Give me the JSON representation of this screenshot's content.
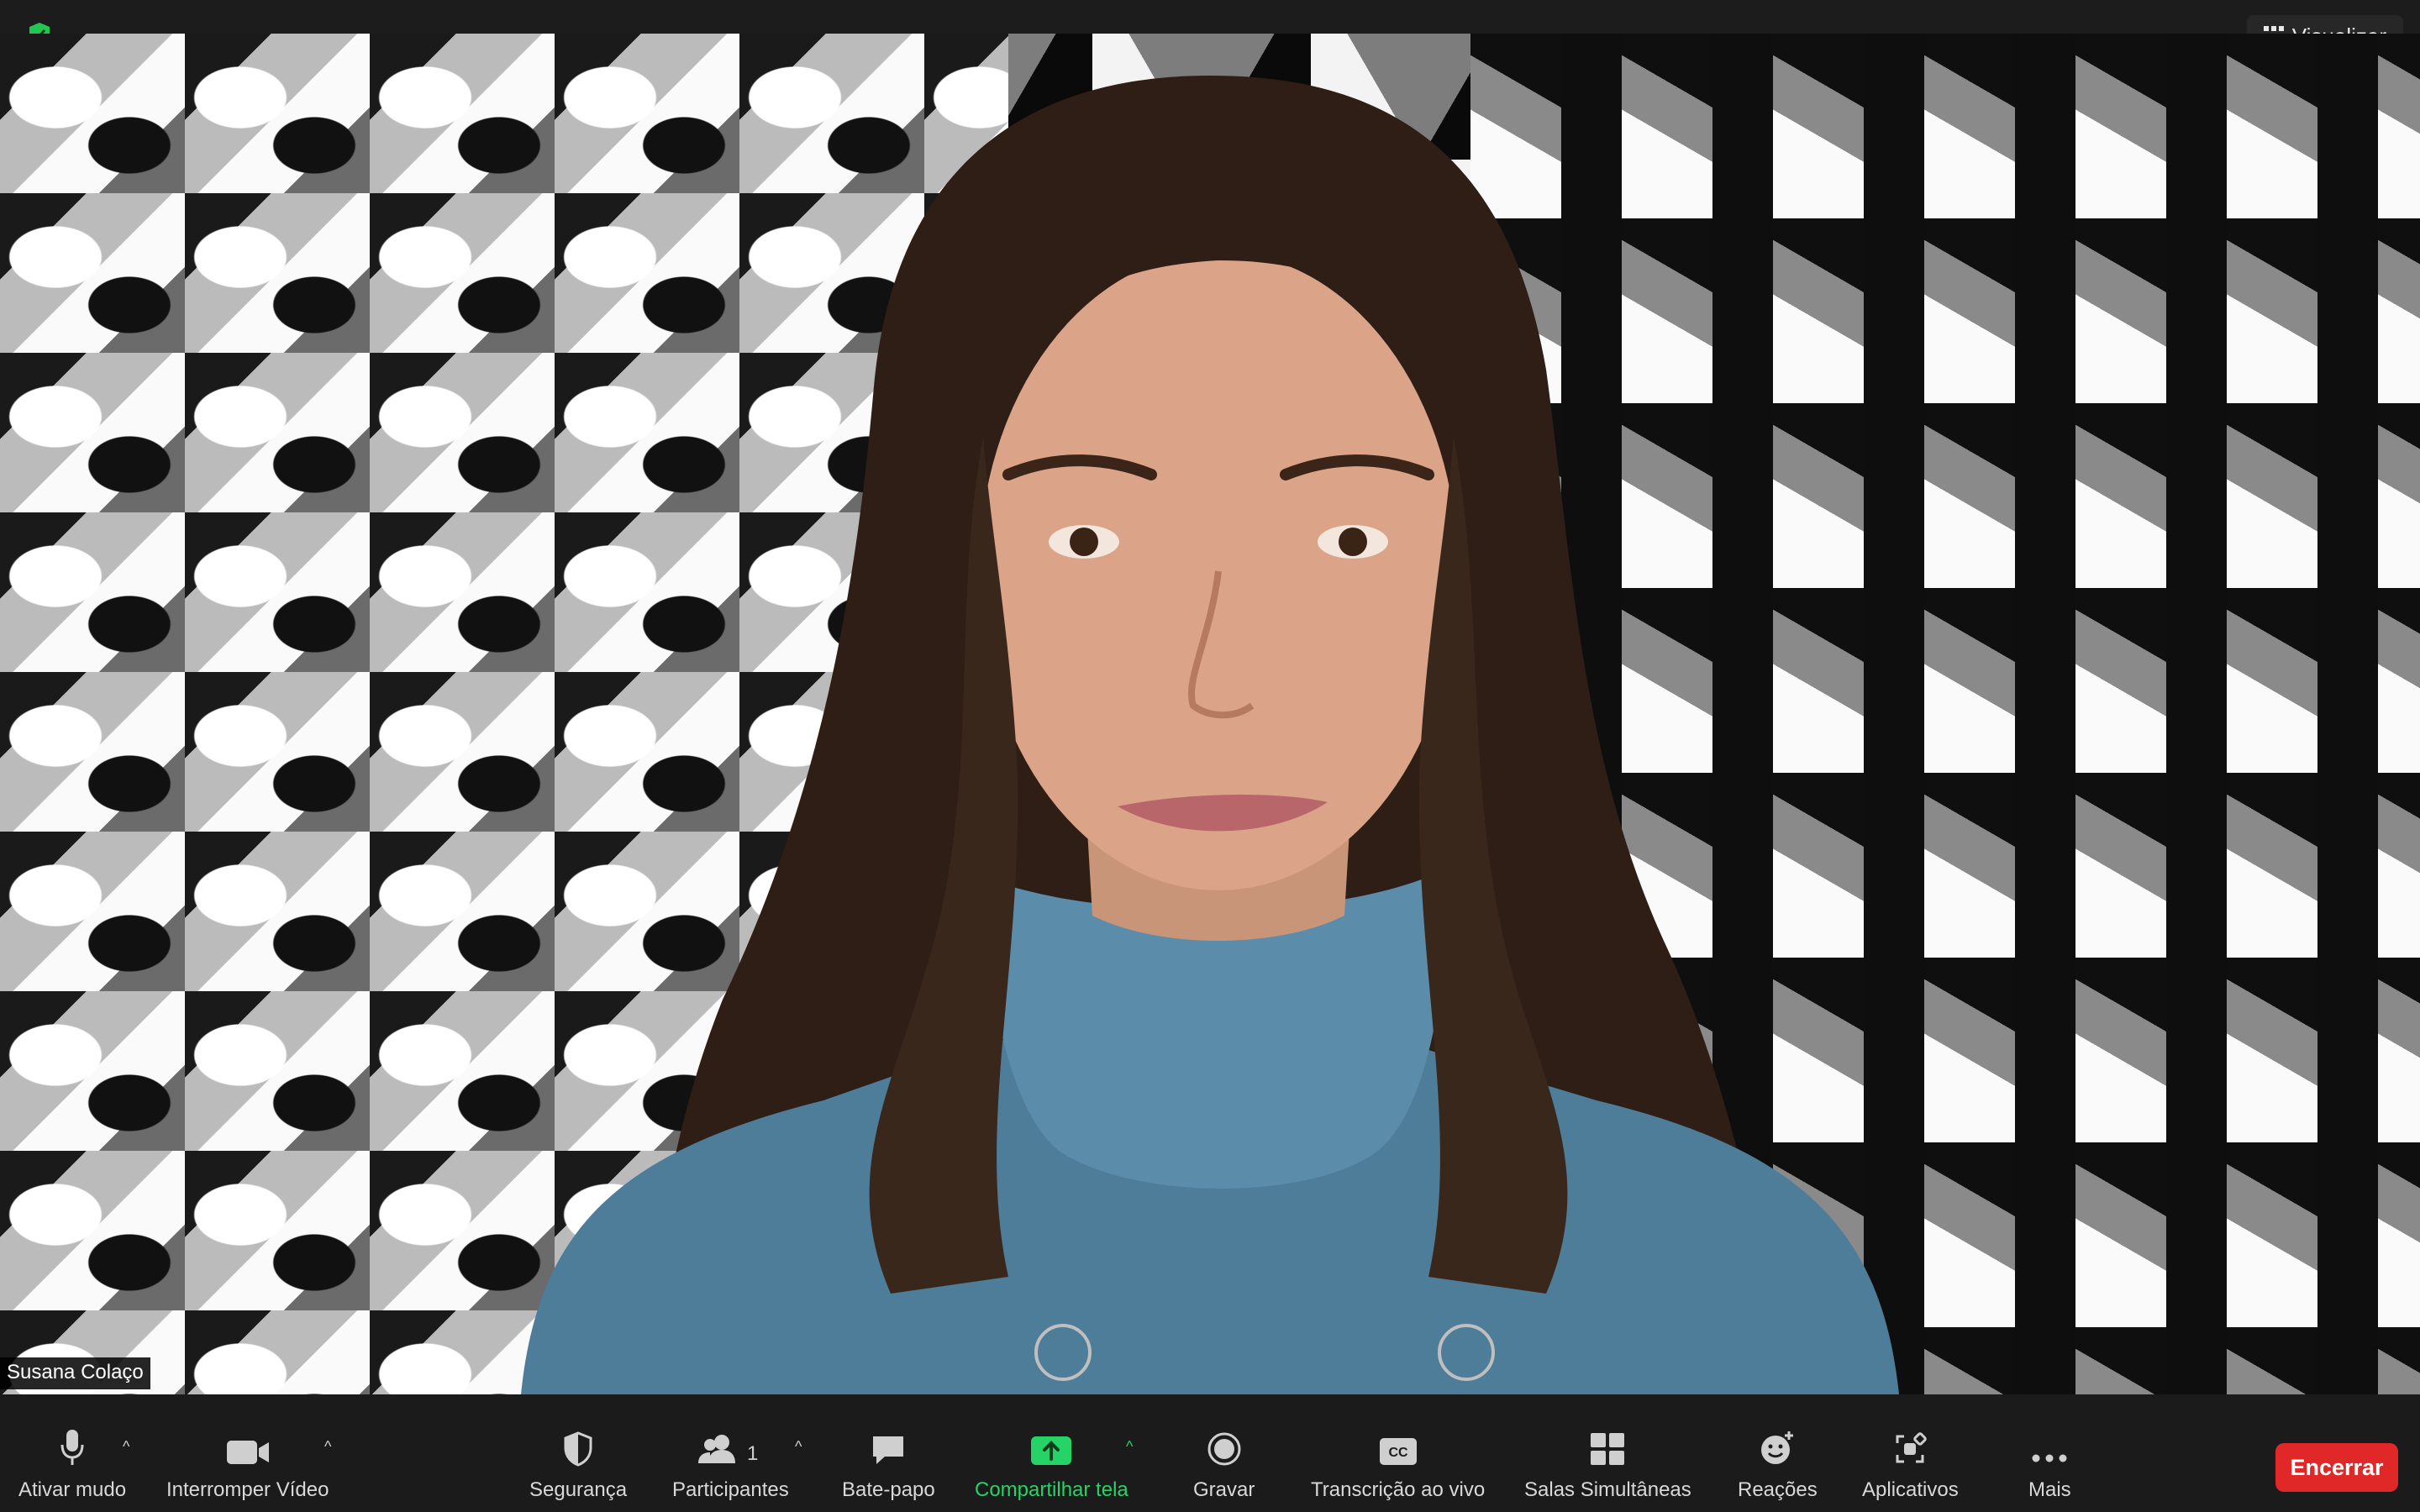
{
  "topbar": {
    "view_label": "Visualizar",
    "shield_color": "#23c552"
  },
  "participant": {
    "name": "Susana Colaço"
  },
  "toolbar": {
    "mute_label": "Ativar mudo",
    "video_label": "Interromper Vídeo",
    "security_label": "Segurança",
    "participants_label": "Participantes",
    "participants_count": "1",
    "chat_label": "Bate-papo",
    "share_label": "Compartilhar tela",
    "record_label": "Gravar",
    "transcription_label": "Transcrição ao vivo",
    "breakout_label": "Salas Simultâneas",
    "reactions_label": "Reações",
    "apps_label": "Aplicativos",
    "more_label": "Mais",
    "end_label": "Encerrar"
  },
  "colors": {
    "share_green": "#25d366",
    "end_red": "#e02828"
  }
}
